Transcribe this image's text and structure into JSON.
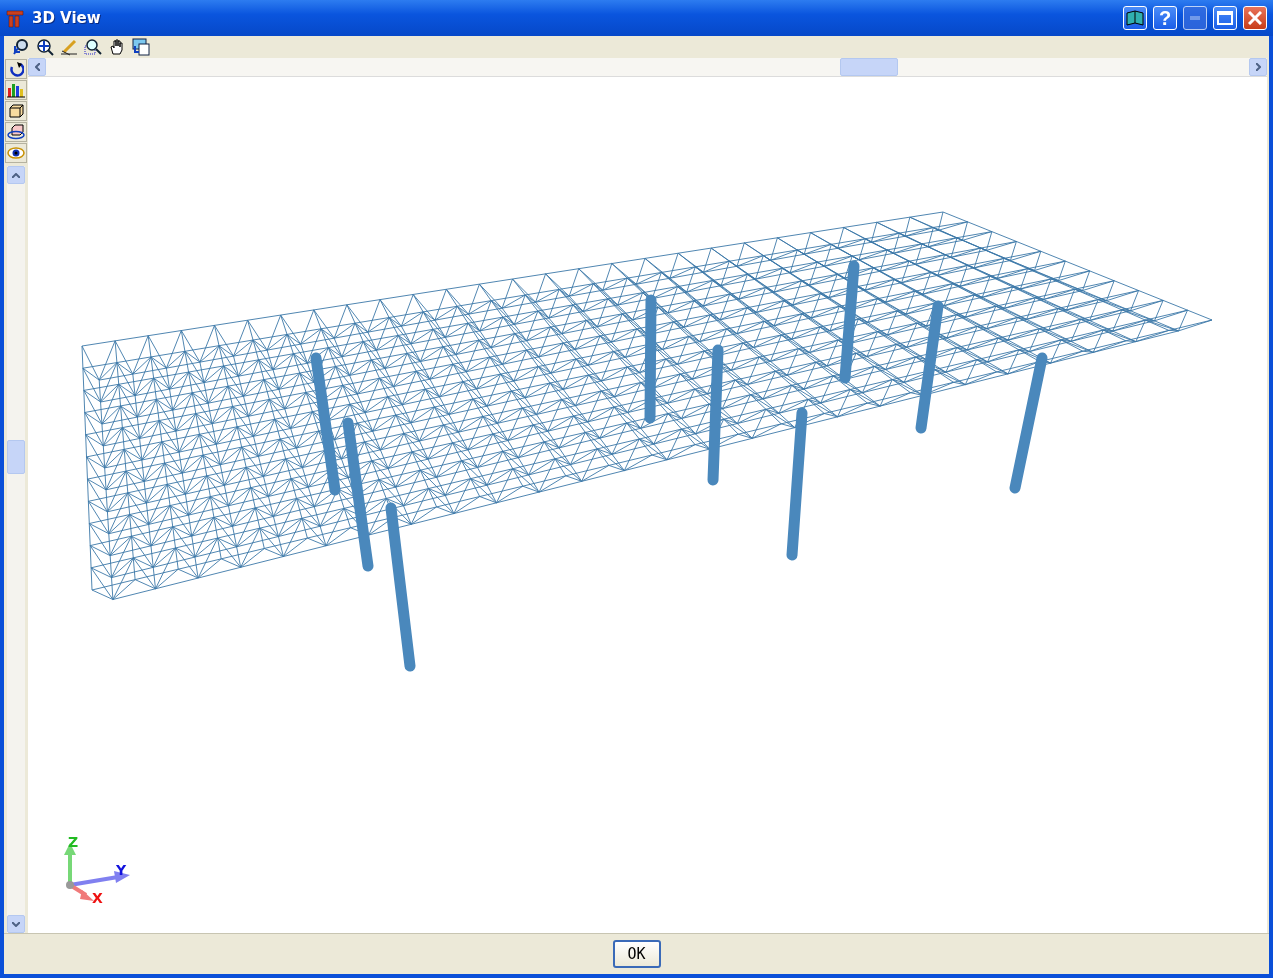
{
  "window": {
    "title": "3D View"
  },
  "title_buttons": [
    {
      "kind": "book"
    },
    {
      "kind": "help",
      "label": "?"
    },
    {
      "kind": "minimize",
      "disabled": true
    },
    {
      "kind": "maximize",
      "disabled": false
    },
    {
      "kind": "close"
    }
  ],
  "toolbar": [
    {
      "kind": "rotate-zoom"
    },
    {
      "kind": "zoom-extents"
    },
    {
      "kind": "pencil"
    },
    {
      "kind": "zoom-window"
    },
    {
      "kind": "pan"
    },
    {
      "kind": "copy"
    }
  ],
  "side_toolbar": [
    {
      "kind": "rotate"
    },
    {
      "kind": "bars"
    },
    {
      "kind": "box"
    },
    {
      "kind": "orbit"
    },
    {
      "kind": "eye"
    }
  ],
  "axes": [
    {
      "label": "Z",
      "color": "#22bb22"
    },
    {
      "label": "Y",
      "color": "#1111dd"
    },
    {
      "label": "X",
      "color": "#ee1111"
    }
  ],
  "buttons": [
    {
      "label": "OK"
    }
  ]
}
